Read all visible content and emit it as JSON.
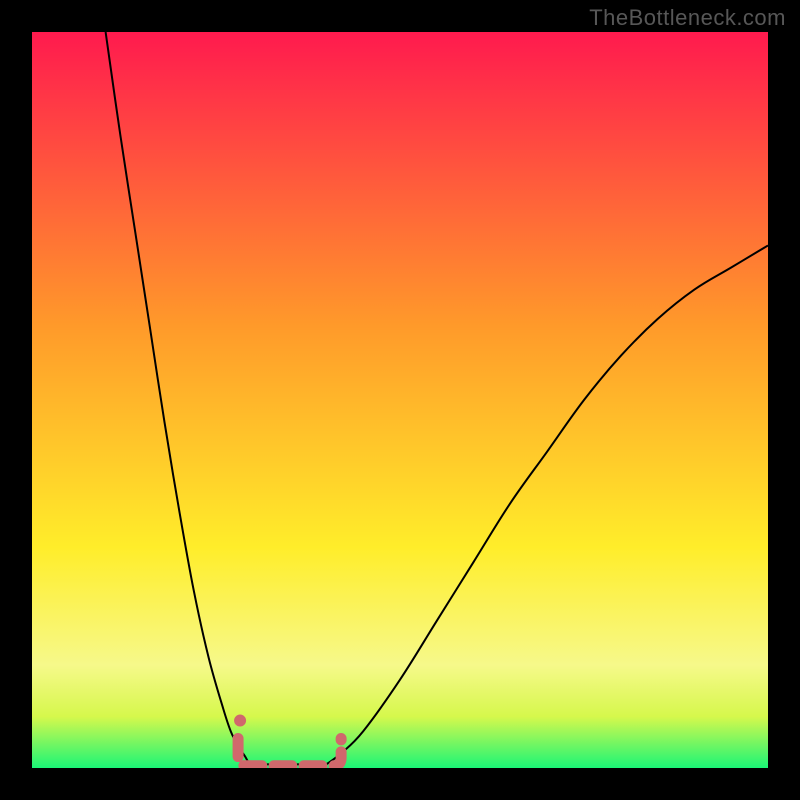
{
  "watermark": "TheBottleneck.com",
  "chart_data": {
    "type": "line",
    "title": "",
    "xlabel": "",
    "ylabel": "",
    "xlim": [
      0,
      100
    ],
    "ylim": [
      0,
      100
    ],
    "gradient": {
      "top_color": "#ff1a4e",
      "mid_color": "#ffed2a",
      "bottom_color": "#1bf576",
      "near_bottom_color": "#d6f84c"
    },
    "series": [
      {
        "name": "left-arm",
        "x": [
          10,
          12,
          14,
          16,
          18,
          20,
          22,
          24,
          26,
          27,
          28,
          29,
          29.5
        ],
        "y": [
          100,
          86,
          73,
          60,
          47,
          35,
          24,
          15,
          8,
          5,
          3,
          1.5,
          0.5
        ]
      },
      {
        "name": "right-arm",
        "x": [
          40,
          42,
          45,
          50,
          55,
          60,
          65,
          70,
          75,
          80,
          85,
          90,
          95,
          100
        ],
        "y": [
          0.5,
          2,
          5,
          12,
          20,
          28,
          36,
          43,
          50,
          56,
          61,
          65,
          68,
          71
        ]
      },
      {
        "name": "floor-segment",
        "x": [
          29.5,
          40
        ],
        "y": [
          0.5,
          0.5
        ]
      },
      {
        "name": "bracket-marker",
        "x_center": 35,
        "width": 14,
        "height": 4,
        "color": "#d0686c",
        "shape": "U"
      }
    ]
  }
}
